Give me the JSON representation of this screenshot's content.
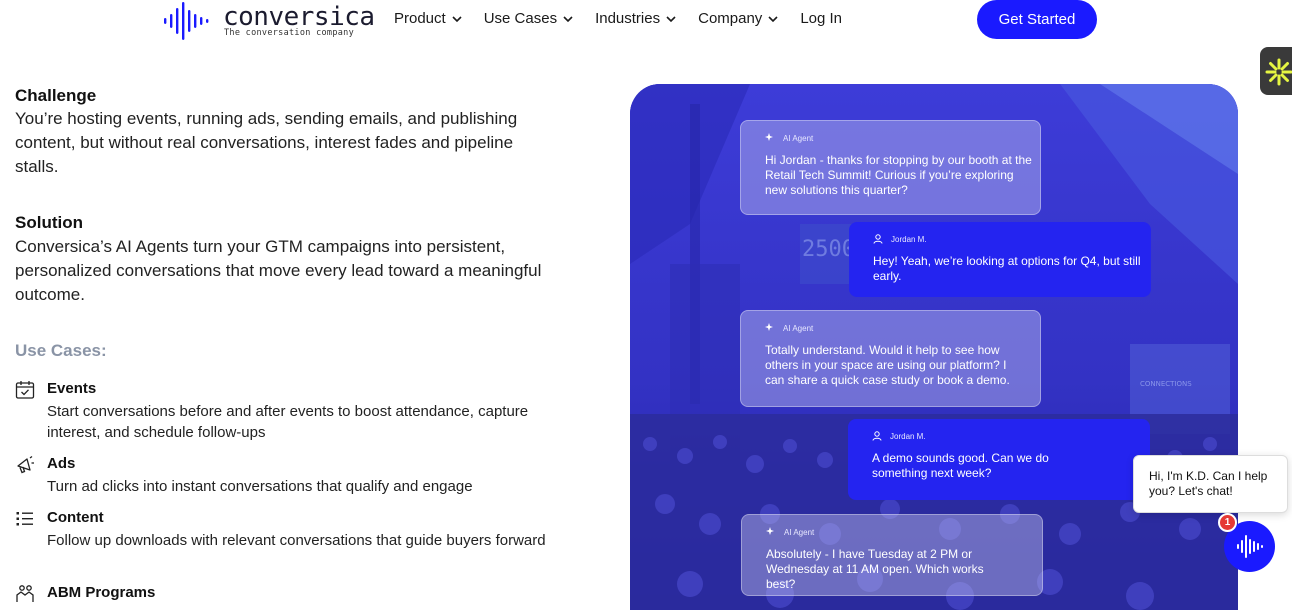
{
  "brand": {
    "name": "conversica",
    "tagline": "The conversation company",
    "accent": "#1a1aff"
  },
  "nav": {
    "items": [
      {
        "label": "Product"
      },
      {
        "label": "Use Cases"
      },
      {
        "label": "Industries"
      },
      {
        "label": "Company"
      }
    ],
    "login": "Log In",
    "cta": "Get Started"
  },
  "content": {
    "challenge_title": "Challenge",
    "challenge_text": "You’re hosting events, running ads, sending emails, and publishing content, but without real conversations, interest fades and pipeline stalls.",
    "solution_title": "Solution",
    "solution_text": "Conversica’s AI Agents turn your GTM campaigns into persistent, personalized conversations that move every lead toward a meaningful outcome.",
    "use_cases_title": "Use Cases:",
    "use_cases": [
      {
        "name": "Events",
        "desc": "Start conversations before and after events to boost attendance, capture interest, and schedule follow-ups",
        "icon": "calendar-check-icon"
      },
      {
        "name": "Ads",
        "desc": "Turn ad clicks into instant conversations that qualify and engage",
        "icon": "megaphone-icon"
      },
      {
        "name": "Content",
        "desc": "Follow up downloads with relevant conversations that guide buyers forward",
        "icon": "list-icon"
      },
      {
        "name": "ABM Programs",
        "desc": "",
        "icon": "handshake-icon"
      }
    ]
  },
  "conversation": {
    "messages": [
      {
        "role": "agent",
        "sender": "AI Agent",
        "text": "Hi Jordan - thanks for stopping by our booth at the Retail Tech Summit! Curious if you’re exploring new solutions this quarter?"
      },
      {
        "role": "user",
        "sender": "Jordan M.",
        "text": "Hey! Yeah, we’re looking at options for Q4, but still early."
      },
      {
        "role": "agent",
        "sender": "AI Agent",
        "text": "Totally understand. Would it help to see how others in your space are using our platform? I can share a quick case study or book a demo."
      },
      {
        "role": "user",
        "sender": "Jordan M.",
        "text": "A demo sounds good. Can we do something next week?"
      },
      {
        "role": "agent",
        "sender": "AI Agent",
        "text": "Absolutely - I have Tuesday at 2 PM or Wednesday at 11 AM open. Which works best?"
      }
    ]
  },
  "chat_widget": {
    "greeting": "Hi, I'm K.D. Can I help you? Let's chat!",
    "badge_count": "1"
  }
}
